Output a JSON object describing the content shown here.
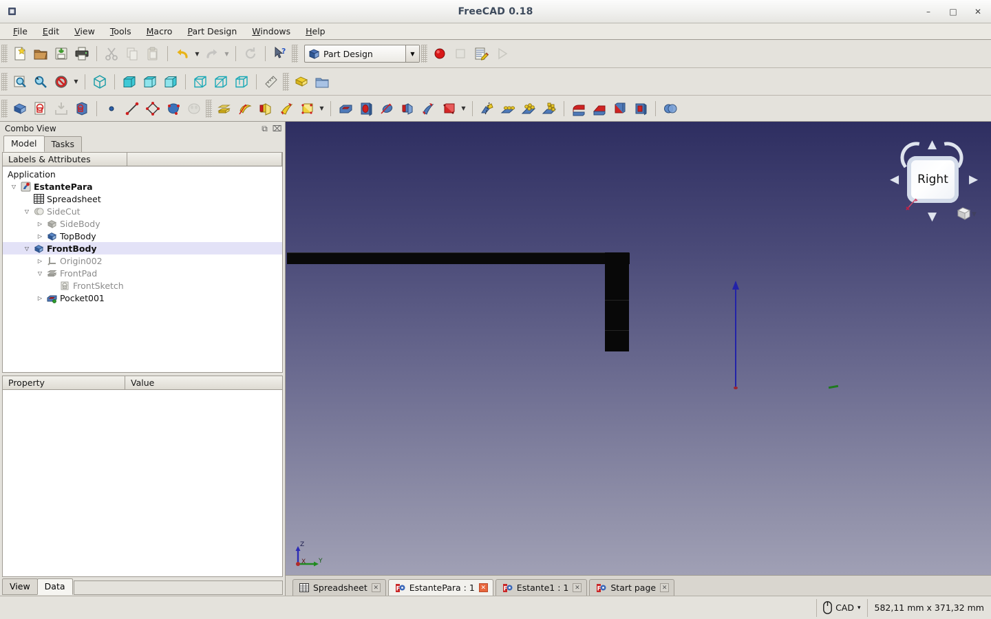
{
  "window": {
    "title": "FreeCAD 0.18",
    "app_icon": "freecad-icon",
    "minimize": "–",
    "maximize": "□",
    "close": "✕"
  },
  "menubar": {
    "items": [
      {
        "label": "File",
        "mnemonic": "F"
      },
      {
        "label": "Edit",
        "mnemonic": "E"
      },
      {
        "label": "View",
        "mnemonic": "V"
      },
      {
        "label": "Tools",
        "mnemonic": "T"
      },
      {
        "label": "Macro",
        "mnemonic": "M"
      },
      {
        "label": "Part Design",
        "mnemonic": "P"
      },
      {
        "label": "Windows",
        "mnemonic": "W"
      },
      {
        "label": "Help",
        "mnemonic": "H"
      }
    ]
  },
  "toolbars": {
    "file": [
      {
        "name": "new-document-icon",
        "label": "New",
        "enabled": true
      },
      {
        "name": "open-document-icon",
        "label": "Open",
        "enabled": true
      },
      {
        "name": "save-document-icon",
        "label": "Save",
        "enabled": true
      },
      {
        "name": "print-icon",
        "label": "Print",
        "enabled": true
      },
      {
        "name": "cut-icon",
        "label": "Cut",
        "enabled": false
      },
      {
        "name": "copy-icon",
        "label": "Copy",
        "enabled": false
      },
      {
        "name": "paste-icon",
        "label": "Paste",
        "enabled": false
      },
      {
        "name": "undo-icon",
        "label": "Undo",
        "enabled": true
      },
      {
        "name": "redo-icon",
        "label": "Redo",
        "enabled": false
      },
      {
        "name": "refresh-icon",
        "label": "Refresh",
        "enabled": false
      },
      {
        "name": "whats-this-icon",
        "label": "What's This",
        "enabled": true
      }
    ],
    "workbench": {
      "selected": "Part Design",
      "icon": "part-design-workbench-icon"
    },
    "macro": [
      {
        "name": "macro-record-icon",
        "label": "Macro recording",
        "enabled": true
      },
      {
        "name": "macro-stop-icon",
        "label": "Stop macro recording",
        "enabled": false
      },
      {
        "name": "macro-edit-icon",
        "label": "Macros",
        "enabled": true
      },
      {
        "name": "macro-execute-icon",
        "label": "Execute macro",
        "enabled": false
      }
    ],
    "view": [
      {
        "name": "fit-all-icon",
        "label": "Fit all",
        "enabled": true
      },
      {
        "name": "fit-selection-icon",
        "label": "Fit selection",
        "enabled": true
      },
      {
        "name": "draw-style-icon",
        "label": "Draw style",
        "enabled": true
      },
      {
        "name": "axonometric-view-icon",
        "label": "Axonometric",
        "enabled": true
      },
      {
        "name": "front-view-icon",
        "label": "Front",
        "enabled": true
      },
      {
        "name": "top-view-icon",
        "label": "Top",
        "enabled": true
      },
      {
        "name": "right-view-icon",
        "label": "Right",
        "enabled": true
      },
      {
        "name": "rear-view-icon",
        "label": "Rear",
        "enabled": true
      },
      {
        "name": "bottom-view-icon",
        "label": "Bottom",
        "enabled": true
      },
      {
        "name": "left-view-icon",
        "label": "Left",
        "enabled": true
      },
      {
        "name": "measure-icon",
        "label": "Measure",
        "enabled": true
      }
    ],
    "structure": [
      {
        "name": "create-part-icon",
        "label": "Create part",
        "enabled": true
      },
      {
        "name": "create-group-icon",
        "label": "Create group",
        "enabled": true
      }
    ],
    "partdesign_helper": [
      {
        "name": "create-body-icon",
        "label": "Create body",
        "enabled": true
      },
      {
        "name": "create-sketch-icon",
        "label": "Create sketch",
        "enabled": true
      },
      {
        "name": "attach-sketch-icon",
        "label": "Attach sketch",
        "enabled": false
      },
      {
        "name": "edit-sketch-icon",
        "label": "Edit sketch",
        "enabled": true
      }
    ],
    "partdesign_datum": [
      {
        "name": "datum-point-icon",
        "label": "Create datum point",
        "enabled": true
      },
      {
        "name": "datum-line-icon",
        "label": "Create datum line",
        "enabled": true
      },
      {
        "name": "datum-plane-icon",
        "label": "Create datum plane",
        "enabled": true
      },
      {
        "name": "shape-binder-icon",
        "label": "Create shape binder",
        "enabled": true
      },
      {
        "name": "clone-icon",
        "label": "Create clone",
        "enabled": false
      }
    ],
    "partdesign_additive": [
      {
        "name": "pad-icon",
        "label": "Pad",
        "enabled": true
      },
      {
        "name": "revolution-icon",
        "label": "Revolution",
        "enabled": true
      },
      {
        "name": "additive-loft-icon",
        "label": "Additive loft",
        "enabled": true
      },
      {
        "name": "additive-pipe-icon",
        "label": "Additive pipe",
        "enabled": true
      },
      {
        "name": "additive-primitive-icon",
        "label": "Additive box",
        "enabled": true
      }
    ],
    "partdesign_subtractive": [
      {
        "name": "pocket-icon",
        "label": "Pocket",
        "enabled": true
      },
      {
        "name": "hole-icon",
        "label": "Hole",
        "enabled": true
      },
      {
        "name": "groove-icon",
        "label": "Groove",
        "enabled": true
      },
      {
        "name": "subtractive-loft-icon",
        "label": "Subtractive loft",
        "enabled": true
      },
      {
        "name": "subtractive-pipe-icon",
        "label": "Subtractive pipe",
        "enabled": true
      },
      {
        "name": "subtractive-primitive-icon",
        "label": "Subtractive box",
        "enabled": true
      }
    ],
    "partdesign_transform": [
      {
        "name": "mirrored-icon",
        "label": "Mirrored",
        "enabled": true
      },
      {
        "name": "linear-pattern-icon",
        "label": "LinearPattern",
        "enabled": true
      },
      {
        "name": "polar-pattern-icon",
        "label": "PolarPattern",
        "enabled": true
      },
      {
        "name": "multi-transform-icon",
        "label": "Create MultiTransform",
        "enabled": true
      }
    ],
    "partdesign_dressup": [
      {
        "name": "fillet-icon",
        "label": "Fillet",
        "enabled": true
      },
      {
        "name": "chamfer-icon",
        "label": "Chamfer",
        "enabled": true
      },
      {
        "name": "draft-icon",
        "label": "Draft",
        "enabled": true
      },
      {
        "name": "thickness-icon",
        "label": "Thickness",
        "enabled": true
      },
      {
        "name": "boolean-icon",
        "label": "Boolean operation",
        "enabled": true
      }
    ]
  },
  "combo_view": {
    "title": "Combo View",
    "float_button": "⧉",
    "close_button": "⌧",
    "tabs": [
      {
        "label": "Model",
        "active": true
      },
      {
        "label": "Tasks",
        "active": false
      }
    ],
    "tree_columns": [
      "Labels & Attributes",
      ""
    ],
    "tree": [
      {
        "label": "Application",
        "indent": 0,
        "twist": "",
        "icon": "",
        "bold": false,
        "grey": false,
        "selected": false
      },
      {
        "label": "EstantePara",
        "indent": 1,
        "twist": "▽",
        "icon": "document-icon",
        "bold": true,
        "grey": false,
        "selected": false
      },
      {
        "label": "Spreadsheet",
        "indent": 2,
        "twist": "",
        "icon": "spreadsheet-icon",
        "bold": false,
        "grey": false,
        "selected": false
      },
      {
        "label": "SideCut",
        "indent": 2,
        "twist": "▽",
        "icon": "boolean-cut-icon",
        "bold": false,
        "grey": true,
        "selected": false
      },
      {
        "label": "SideBody",
        "indent": 3,
        "twist": "▷",
        "icon": "body-icon",
        "bold": false,
        "grey": true,
        "selected": false
      },
      {
        "label": "TopBody",
        "indent": 3,
        "twist": "▷",
        "icon": "body-icon",
        "bold": false,
        "grey": false,
        "selected": false
      },
      {
        "label": "FrontBody",
        "indent": 2,
        "twist": "▽",
        "icon": "body-icon",
        "bold": true,
        "grey": false,
        "selected": true
      },
      {
        "label": "Origin002",
        "indent": 3,
        "twist": "▷",
        "icon": "origin-icon",
        "bold": false,
        "grey": true,
        "selected": false
      },
      {
        "label": "FrontPad",
        "indent": 3,
        "twist": "▽",
        "icon": "pad-icon",
        "bold": false,
        "grey": true,
        "selected": false
      },
      {
        "label": "FrontSketch",
        "indent": 4,
        "twist": "",
        "icon": "sketch-icon",
        "bold": false,
        "grey": true,
        "selected": false
      },
      {
        "label": "Pocket001",
        "indent": 3,
        "twist": "▷",
        "icon": "pocket-icon",
        "bold": false,
        "grey": false,
        "selected": false
      }
    ],
    "property_columns": [
      "Property",
      "Value"
    ],
    "property_rows": [],
    "bottom_tabs": [
      {
        "label": "View",
        "active": false
      },
      {
        "label": "Data",
        "active": true
      }
    ]
  },
  "viewport": {
    "nav_cube": {
      "face_label": "Right",
      "arrow_up": "▲",
      "arrow_down": "▼",
      "arrow_left": "◀",
      "arrow_right": "▶",
      "home_icon": "home-cube-icon",
      "home_dropdown": "▼"
    },
    "axis_cross": {
      "x": "X",
      "y": "Y",
      "z": "Z",
      "x_color": "#b02a2a",
      "y_color": "#1f8a1f",
      "z_color": "#2b2bb5"
    },
    "background_top": "#2e2e61",
    "background_bottom": "#a0a0b5",
    "object_color": "#090909"
  },
  "mdi_tabs": [
    {
      "label": "Spreadsheet",
      "icon": "spreadsheet-icon",
      "active": false,
      "close": "✕"
    },
    {
      "label": "EstantePara : 1",
      "icon": "freecad-doc-icon",
      "active": true,
      "close": "✕"
    },
    {
      "label": "Estante1 : 1",
      "icon": "freecad-doc-icon",
      "active": false,
      "close": "✕"
    },
    {
      "label": "Start page",
      "icon": "freecad-doc-icon",
      "active": false,
      "close": "✕"
    }
  ],
  "statusbar": {
    "message": "",
    "navigation_style": "CAD",
    "navigation_dropdown": "▾",
    "navigation_icon": "mouse-icon",
    "dimensions": "582,11 mm x 371,32 mm"
  }
}
